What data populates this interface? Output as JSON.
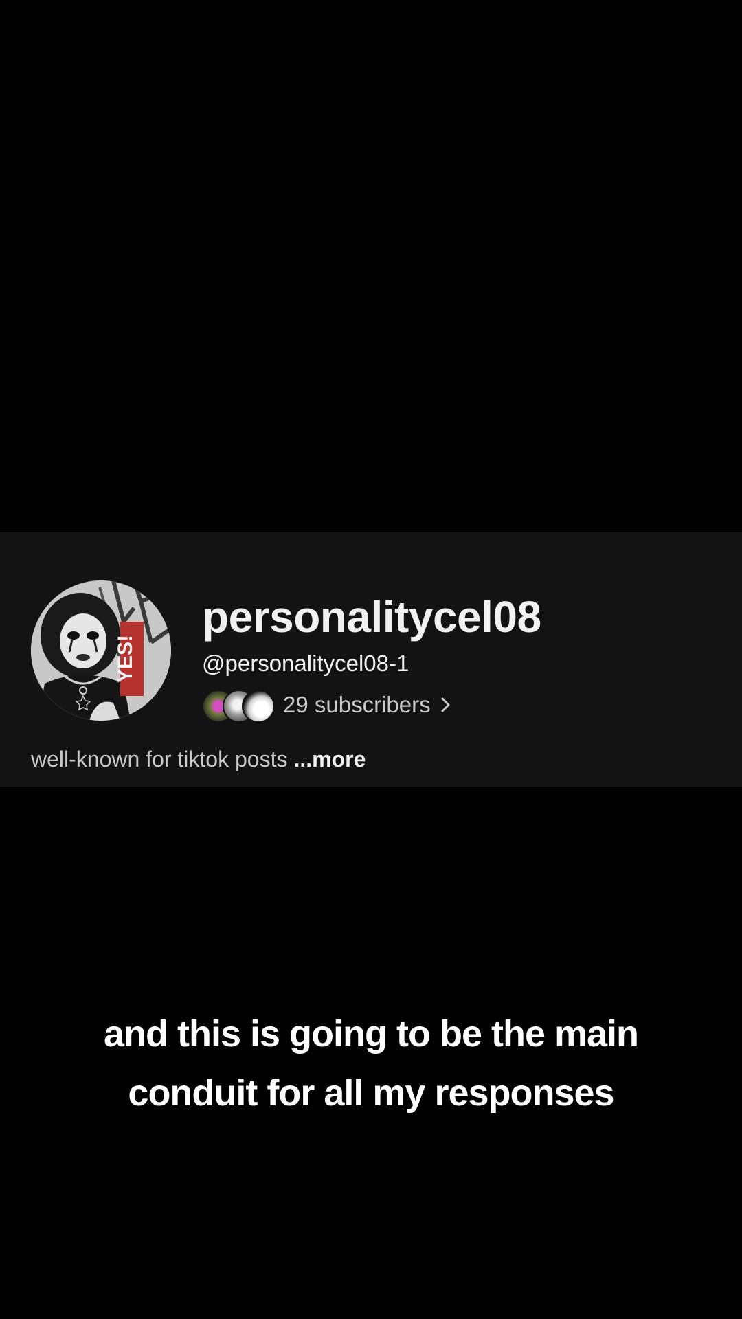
{
  "channel": {
    "name": "personalitycel08",
    "handle": "@personalitycel08-1",
    "subscribers_text": "29 subscribers",
    "description": "well-known for tiktok posts",
    "more_label": "...more",
    "avatar_badge_text": "YES!"
  },
  "caption": {
    "line1": "and this is going to be the main",
    "line2": "conduit for all my responses"
  },
  "colors": {
    "background": "#000000",
    "card_background": "#131313",
    "primary_text": "#f1f1f1",
    "secondary_text": "#c9c9c9",
    "avatar_badge": "#b5322e"
  },
  "icons": {
    "subscribers_chevron": "chevron-right-icon"
  }
}
